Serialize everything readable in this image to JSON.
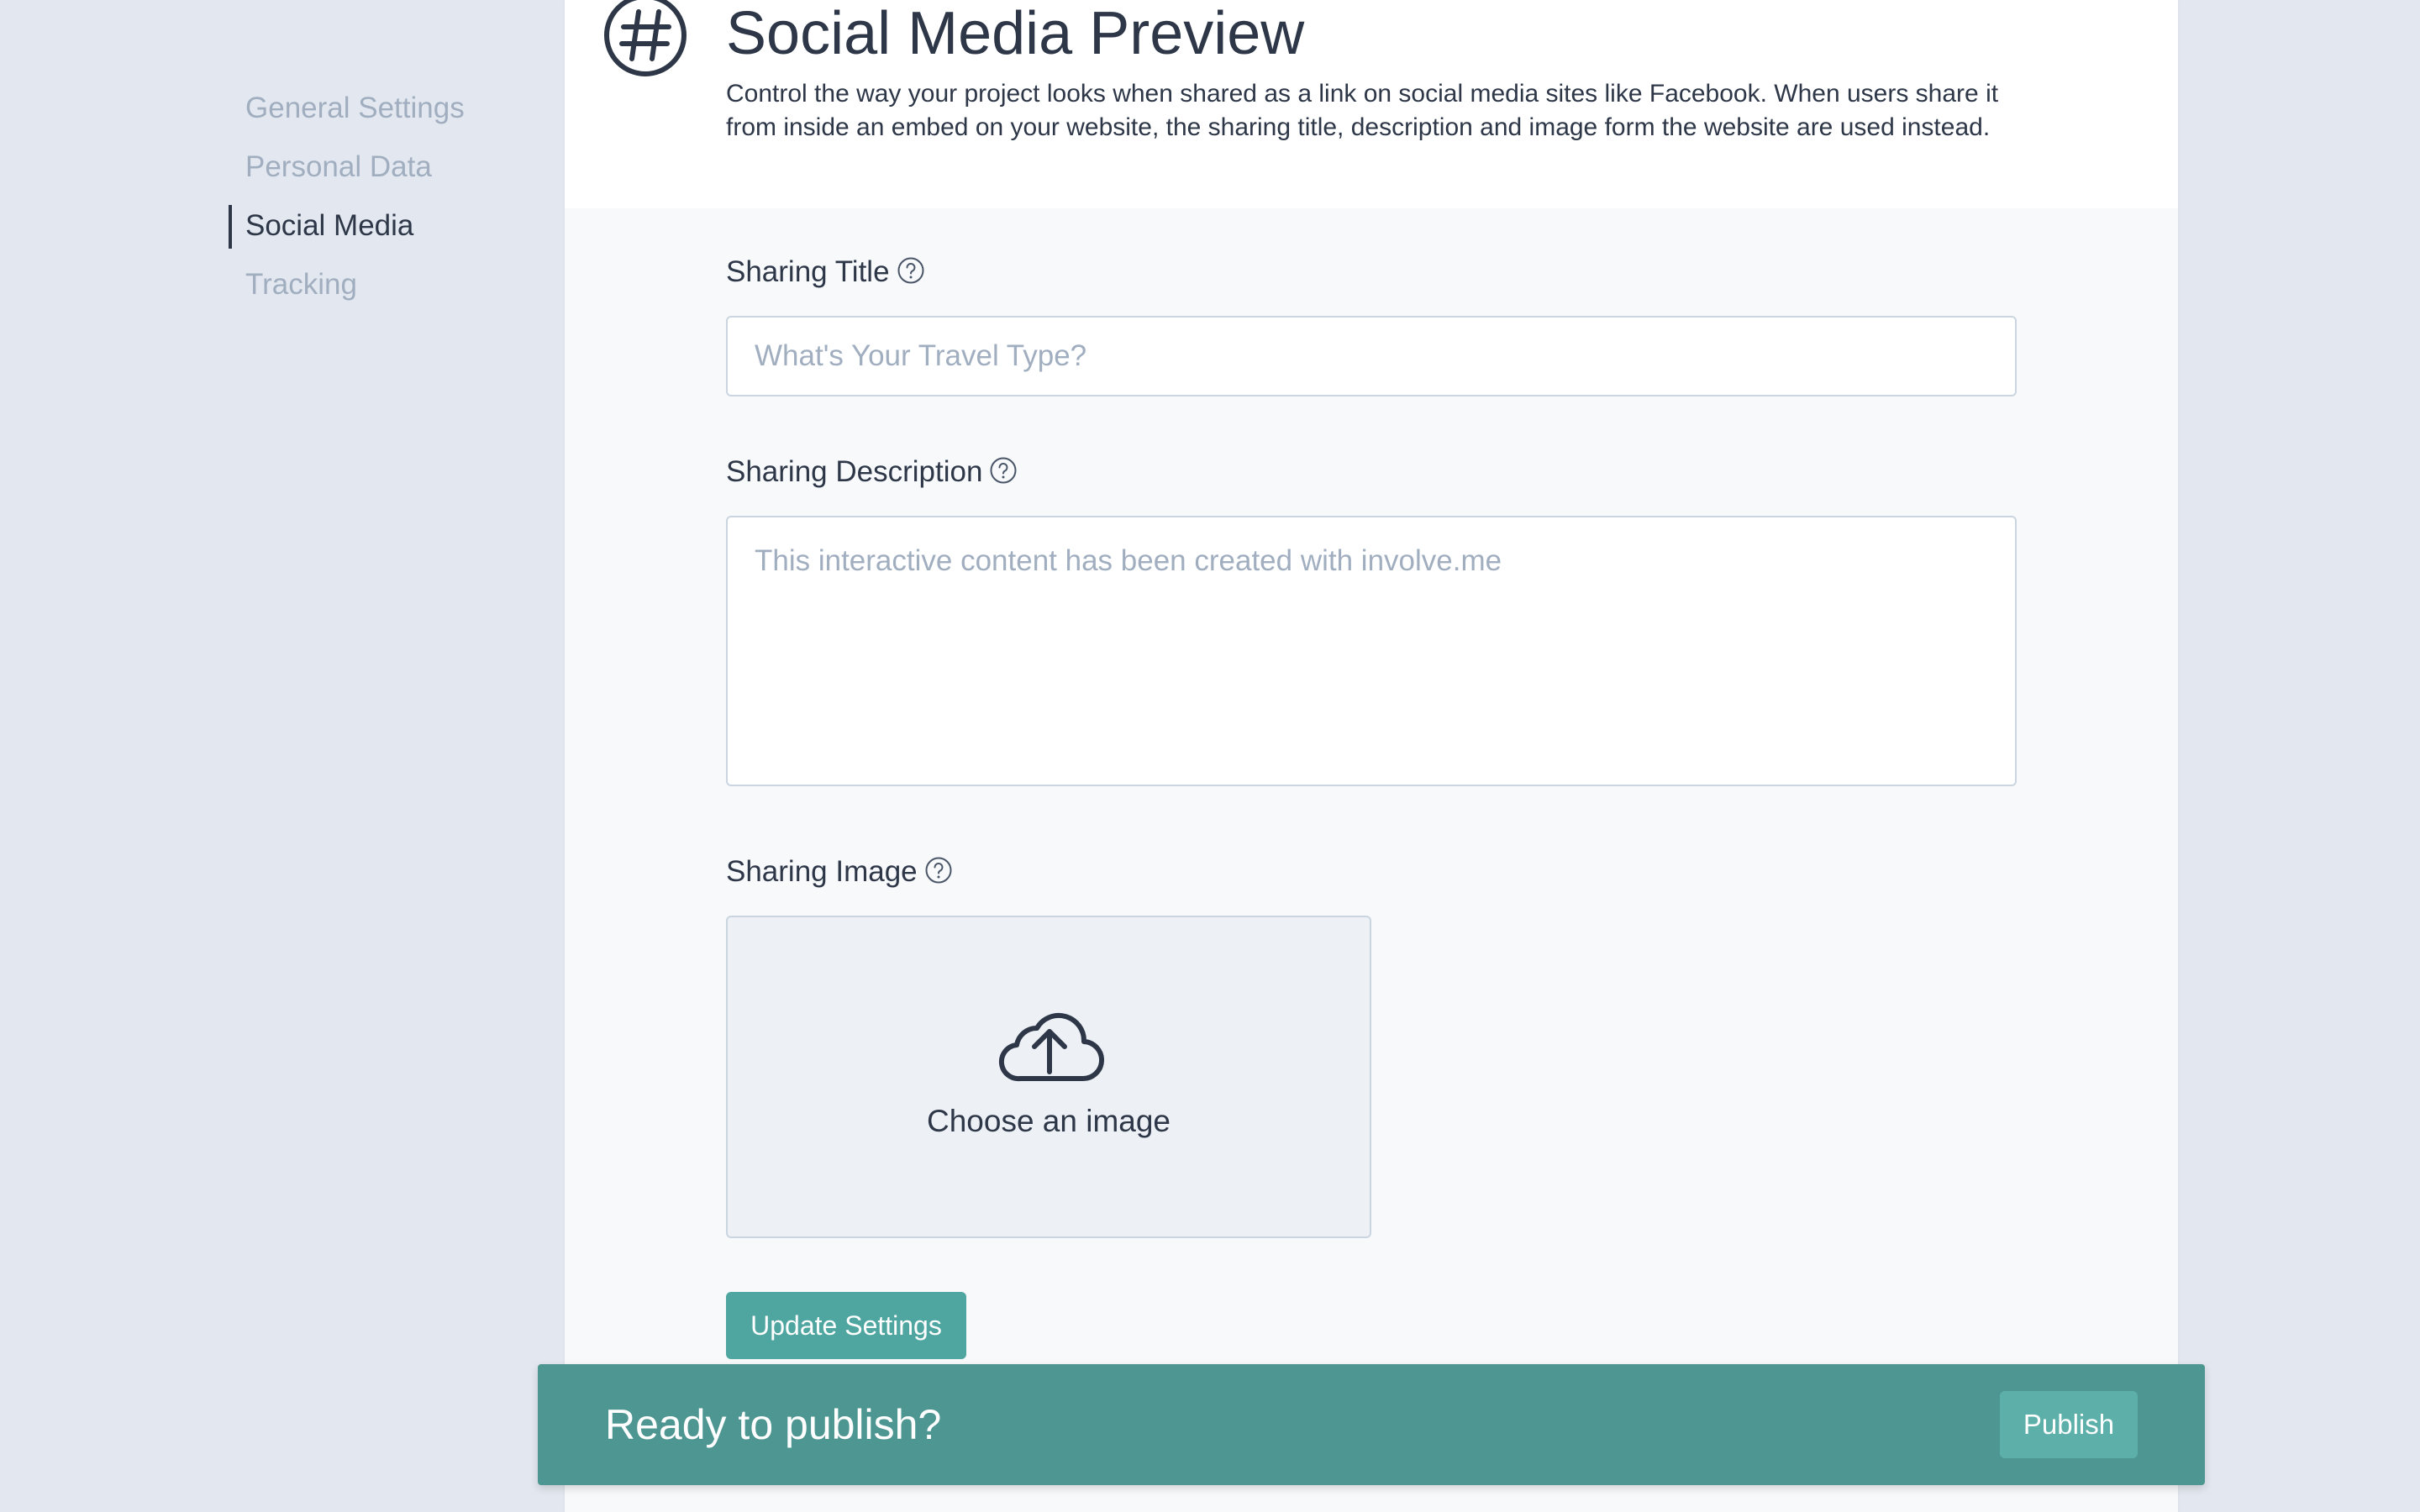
{
  "sidebar": {
    "items": [
      {
        "label": "General Settings",
        "active": false
      },
      {
        "label": "Personal Data",
        "active": false
      },
      {
        "label": "Social Media",
        "active": true
      },
      {
        "label": "Tracking",
        "active": false
      }
    ]
  },
  "header": {
    "icon": "hashtag-icon",
    "title": "Social Media Preview",
    "description": "Control the way your project looks when shared as a link on social media sites like Facebook. When users share it from inside an embed on your website, the sharing title, description and image form the website are used instead."
  },
  "form": {
    "sharing_title": {
      "label": "Sharing Title",
      "value": "",
      "placeholder": "What's Your Travel Type?"
    },
    "sharing_description": {
      "label": "Sharing Description",
      "value": "",
      "placeholder": "This interactive content has been created with involve.me"
    },
    "sharing_image": {
      "label": "Sharing Image",
      "icon": "cloud-upload-icon",
      "dropzone_label": "Choose an image"
    },
    "update_button": "Update Settings"
  },
  "publish_bar": {
    "text": "Ready to publish?",
    "button": "Publish"
  },
  "colors": {
    "accent": "#4fa6a0",
    "publish_bar": "#4e9691",
    "text": "#2d3748",
    "muted": "#a0aec0",
    "background": "#e3e8f0"
  }
}
